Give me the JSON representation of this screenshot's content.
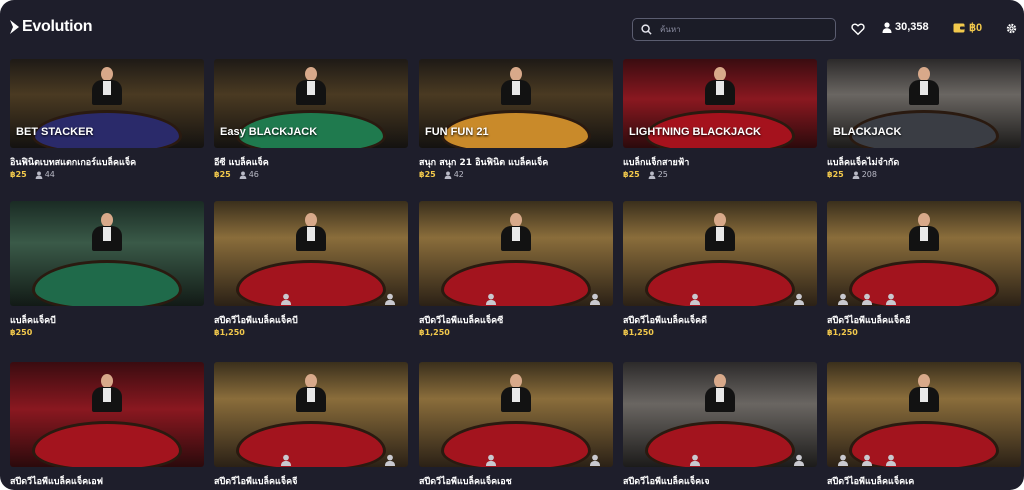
{
  "header": {
    "logo_text": "Evolution",
    "search_placeholder": "ค้นหา",
    "players_count": "30,358",
    "balance": "฿0"
  },
  "colors": {
    "background": "#1e1e2b",
    "accent": "#f2c94c",
    "seat_text": "#b9bac6"
  },
  "rows": [
    {
      "cards": [
        {
          "title": "อินฟินิตเบทสแตกเกอร์แบล็คแจ็ค",
          "bet": "฿25",
          "seats": "44",
          "badge": "BET STACKER",
          "theme": "bg-dark",
          "felt": "#2a2a6a"
        },
        {
          "title": "อีซี แบล็คแจ็ค",
          "bet": "฿25",
          "seats": "46",
          "badge": "Easy BLACKJACK",
          "theme": "bg-dark",
          "felt": "#1f7a4e"
        },
        {
          "title": "สนุก สนุก 21 อินฟินิต แบล็คแจ็ค",
          "bet": "฿25",
          "seats": "42",
          "badge": "FUN FUN 21",
          "theme": "bg-dark",
          "felt": "#c98a2a"
        },
        {
          "title": "แบล็กแจ็กสายฟ้า",
          "bet": "฿25",
          "seats": "25",
          "badge": "LIGHTNING BLACKJACK",
          "theme": "bg-red",
          "felt": "#a5121d"
        },
        {
          "title": "แบล็คแจ็คไม่จำกัด",
          "bet": "฿25",
          "seats": "208",
          "badge": "BLACKJACK",
          "theme": "bg-grey",
          "felt": "#3a3d44"
        }
      ]
    },
    {
      "cards": [
        {
          "title": "แบล็คแจ็คบี",
          "bet": "฿250",
          "theme": "bg-green",
          "felt": "#1f6a4a"
        },
        {
          "title": "สปีดวีไอพีแบล็คแจ็คบี",
          "bet": "฿1,250",
          "theme": "bg-gold",
          "felt": "#a3141e"
        },
        {
          "title": "สปีดวีไอพีแบล็คแจ็คซี",
          "bet": "฿1,250",
          "theme": "bg-gold",
          "felt": "#a3141e"
        },
        {
          "title": "สปีดวีไอพีแบล็คแจ็คดี",
          "bet": "฿1,250",
          "theme": "bg-gold",
          "felt": "#a3141e"
        },
        {
          "title": "สปีดวีไอพีแบล็คแจ็คอี",
          "bet": "฿1,250",
          "theme": "bg-gold",
          "felt": "#a3141e"
        }
      ]
    },
    {
      "cards": [
        {
          "title": "สปีดวีไอพีแบล็คแจ็คเอฟ",
          "theme": "bg-red",
          "felt": "#a3141e"
        },
        {
          "title": "สปีดวีไอพีแบล็คแจ็คจี",
          "theme": "bg-gold",
          "felt": "#a3141e"
        },
        {
          "title": "สปีดวีไอพีแบล็คแจ็คเอช",
          "theme": "bg-gold",
          "felt": "#a3141e"
        },
        {
          "title": "สปีดวีไอพีแบล็คแจ็คเจ",
          "theme": "bg-grey",
          "felt": "#a3141e"
        },
        {
          "title": "สปีดวีไอพีแบล็คแจ็คเค",
          "theme": "bg-gold",
          "felt": "#a3141e"
        }
      ]
    }
  ]
}
